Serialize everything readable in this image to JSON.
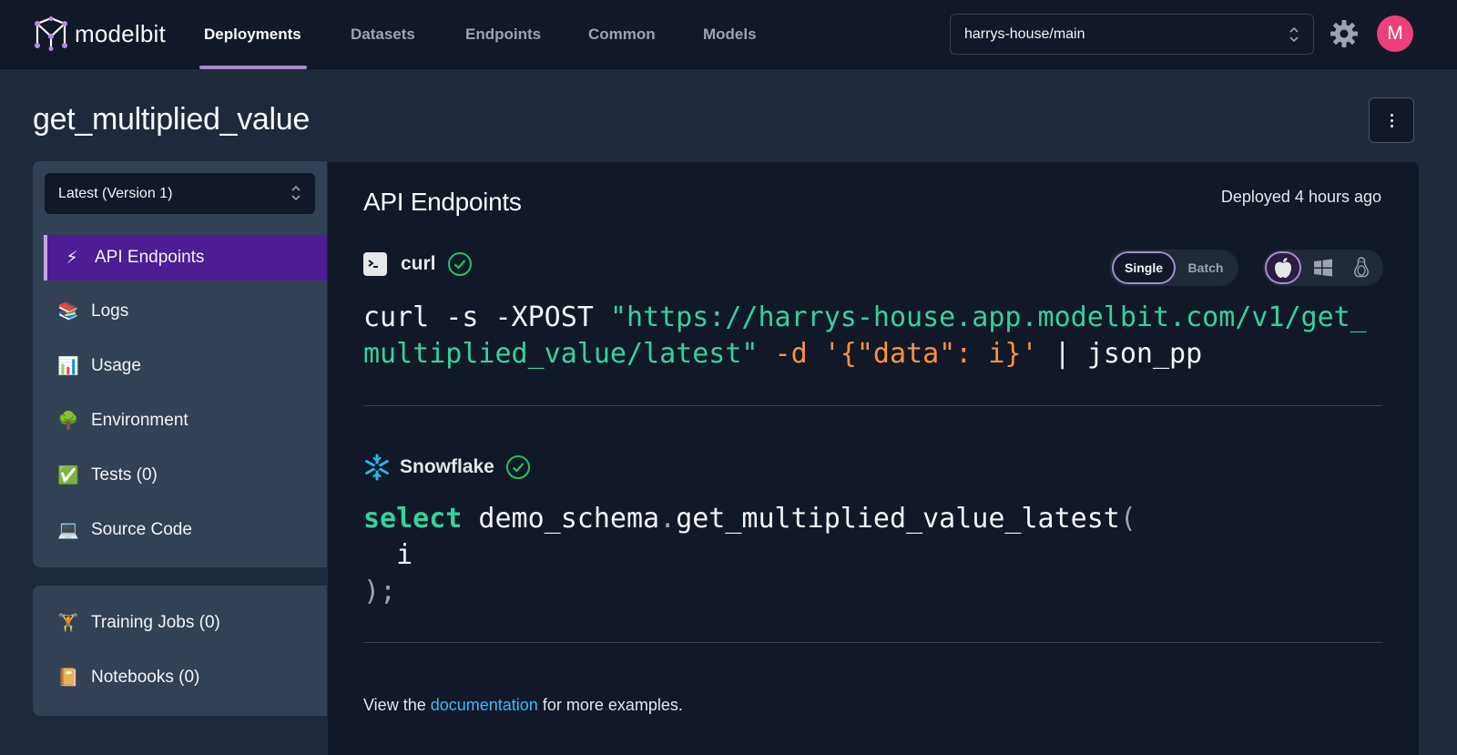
{
  "app": {
    "name": "modelbit"
  },
  "nav": {
    "tabs": [
      {
        "label": "Deployments",
        "active": true
      },
      {
        "label": "Datasets",
        "active": false
      },
      {
        "label": "Endpoints",
        "active": false
      },
      {
        "label": "Common",
        "active": false
      },
      {
        "label": "Models",
        "active": false
      }
    ],
    "branch": "harrys-house/main",
    "settings_icon": "gear-icon",
    "avatar_initial": "M"
  },
  "page": {
    "title": "get_multiplied_value"
  },
  "sidebar": {
    "version": "Latest (Version 1)",
    "items": [
      {
        "emoji": "⚡",
        "label": "API Endpoints",
        "active": true
      },
      {
        "emoji": "📚",
        "label": "Logs"
      },
      {
        "emoji": "📊",
        "label": "Usage"
      },
      {
        "emoji": "🌳",
        "label": "Environment"
      },
      {
        "emoji": "✅",
        "label": "Tests (0)"
      },
      {
        "emoji": "💻",
        "label": "Source Code"
      }
    ],
    "secondary": [
      {
        "emoji": "🏋",
        "label": "Training Jobs (0)"
      },
      {
        "emoji": "📔",
        "label": "Notebooks (0)"
      }
    ]
  },
  "main": {
    "title": "API Endpoints",
    "deployed": "Deployed 4 hours ago",
    "curl": {
      "label": "curl",
      "mode_single": "Single",
      "mode_batch": "Batch",
      "selected_mode": "Single",
      "selected_os": "apple",
      "cmd_start": "curl -s -XPOST ",
      "url_line1": "\"https://harrys-house.app.modelbit.com/v1/get_",
      "url_line2": "multiplied_value/latest\"",
      "opt_d": " -d ",
      "payload": "'{\"data\": i}'",
      "pipe": " | json_pp"
    },
    "snowflake": {
      "label": "Snowflake",
      "keyword": "select",
      "func": " demo_schema",
      "dot": ".",
      "name": "get_multiplied_value_latest",
      "open": "(",
      "arg": "  i",
      "close": ");"
    },
    "footer": {
      "prefix": "View the ",
      "link": "documentation",
      "suffix": " for more examples."
    }
  }
}
